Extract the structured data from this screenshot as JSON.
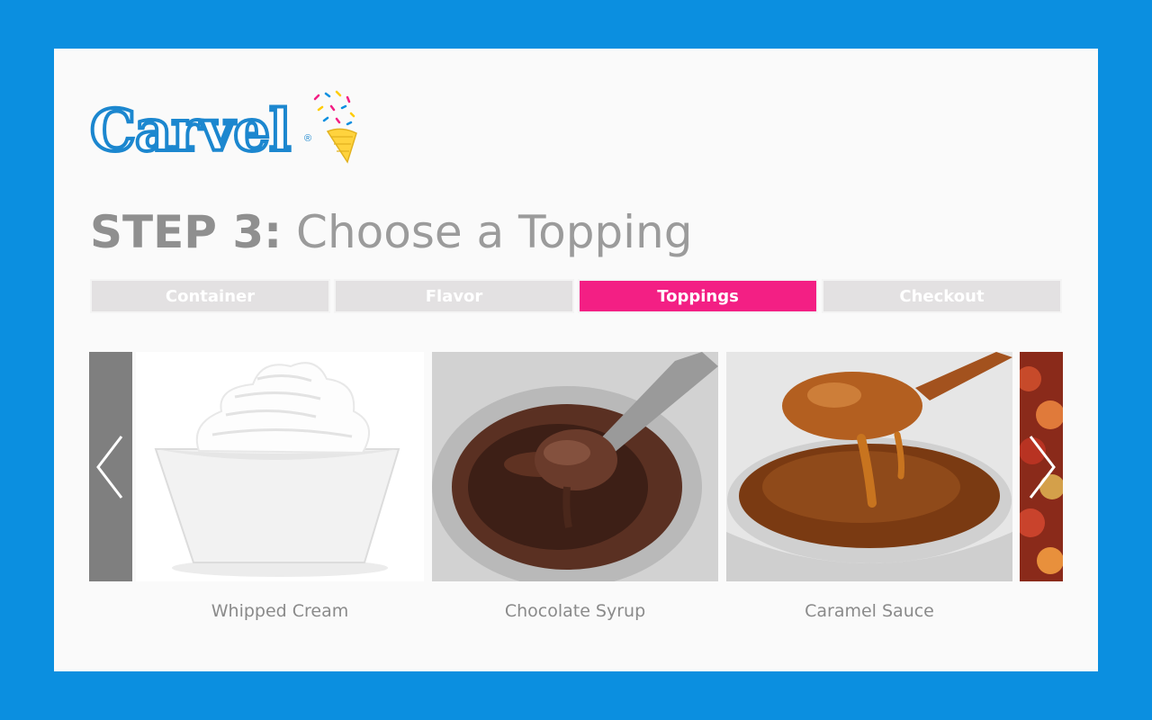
{
  "brand": {
    "name": "Carvel",
    "registered_mark": "®"
  },
  "step": {
    "number_label": "STEP 3:",
    "title": "Choose a Topping"
  },
  "tabs": [
    {
      "label": "Container",
      "active": false
    },
    {
      "label": "Flavor",
      "active": false
    },
    {
      "label": "Toppings",
      "active": true
    },
    {
      "label": "Checkout",
      "active": false
    }
  ],
  "toppings": [
    {
      "label": "Whipped Cream"
    },
    {
      "label": "Chocolate Syrup"
    },
    {
      "label": "Caramel Sauce"
    }
  ],
  "icons": {
    "prev": "chevron-left-icon",
    "next": "chevron-right-icon"
  },
  "colors": {
    "background": "#0b8fe0",
    "card": "#fafafa",
    "active_tab": "#f31f84",
    "inactive_tab": "#e3e1e2",
    "arrow_panel": "#7f7f7f",
    "logo_blue": "#1c87cf",
    "muted_text": "#8a8a8a"
  }
}
